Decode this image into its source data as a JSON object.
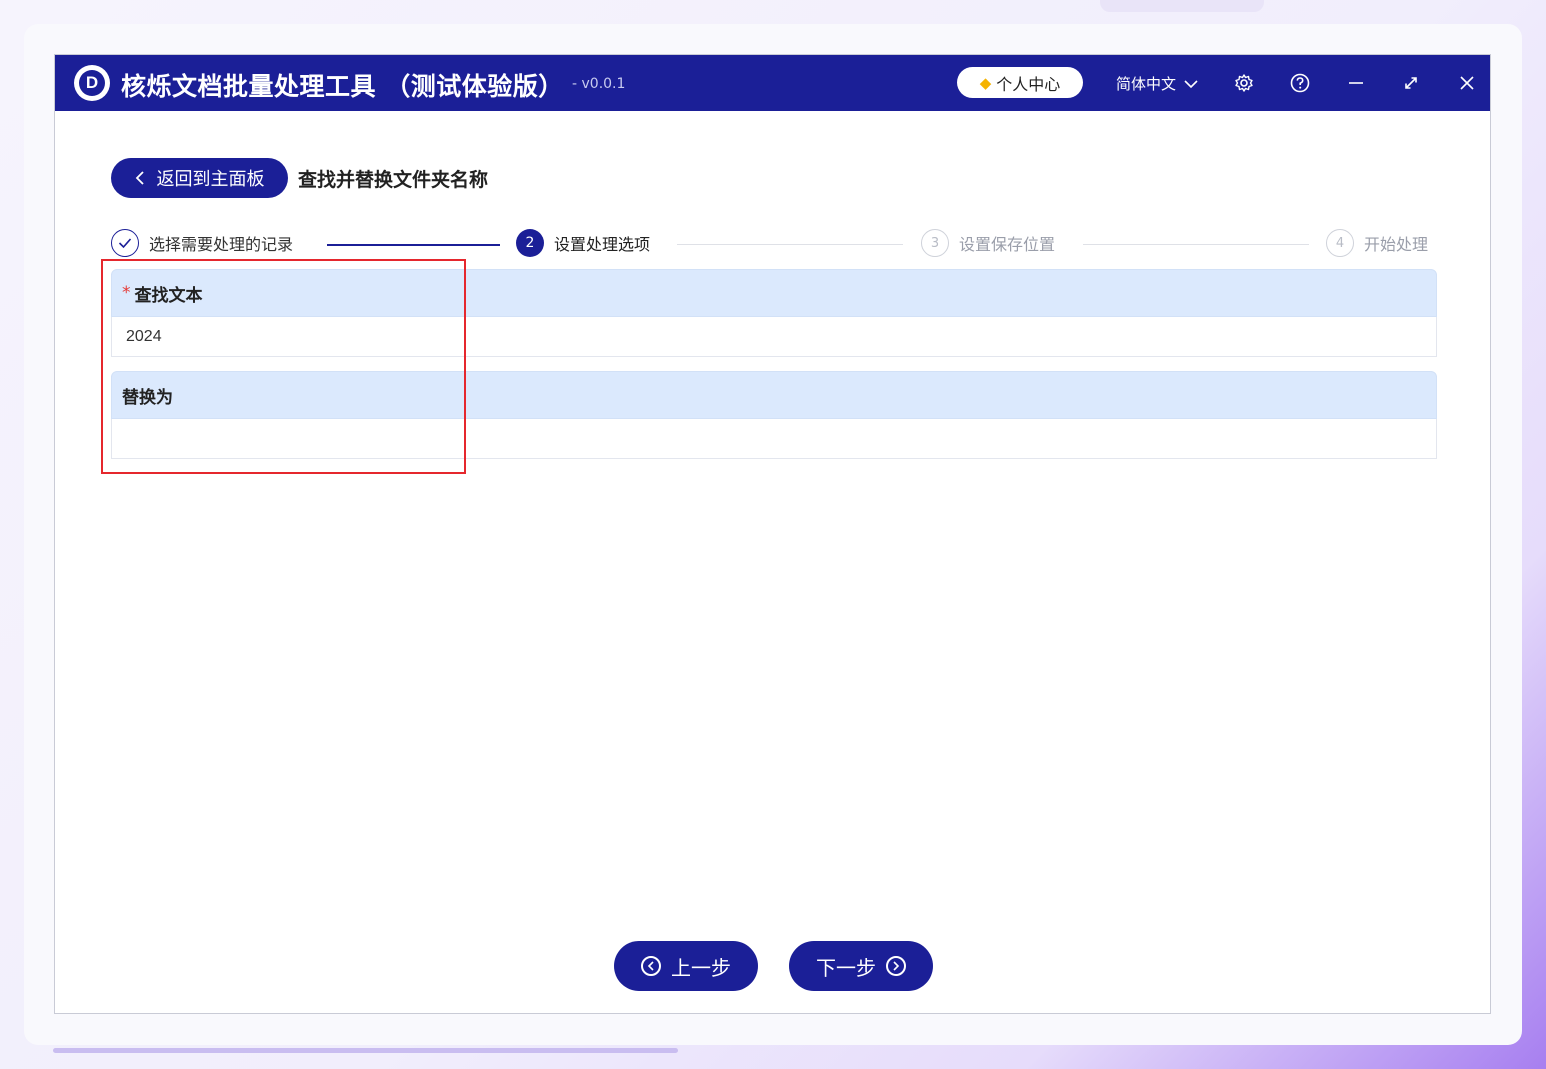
{
  "app": {
    "logo_letter": "D",
    "title": "核烁文档批量处理工具 （测试体验版）",
    "version": "- v0.0.1",
    "user_center": "个人中心",
    "language": "简体中文"
  },
  "page": {
    "back_label": "返回到主面板",
    "title": "查找并替换文件夹名称"
  },
  "steps": [
    {
      "index": "1",
      "label": "选择需要处理的记录",
      "state": "done"
    },
    {
      "index": "2",
      "label": "设置处理选项",
      "state": "active"
    },
    {
      "index": "3",
      "label": "设置保存位置",
      "state": "todo"
    },
    {
      "index": "4",
      "label": "开始处理",
      "state": "todo"
    }
  ],
  "fields": {
    "find": {
      "required_mark": "*",
      "label": "查找文本",
      "value": "2024"
    },
    "replace": {
      "label": "替换为",
      "value": ""
    }
  },
  "nav": {
    "prev": "上一步",
    "next": "下一步"
  },
  "colors": {
    "brand": "#1b1f97",
    "field_header": "#dbe9fd",
    "highlight": "#e5272d"
  }
}
